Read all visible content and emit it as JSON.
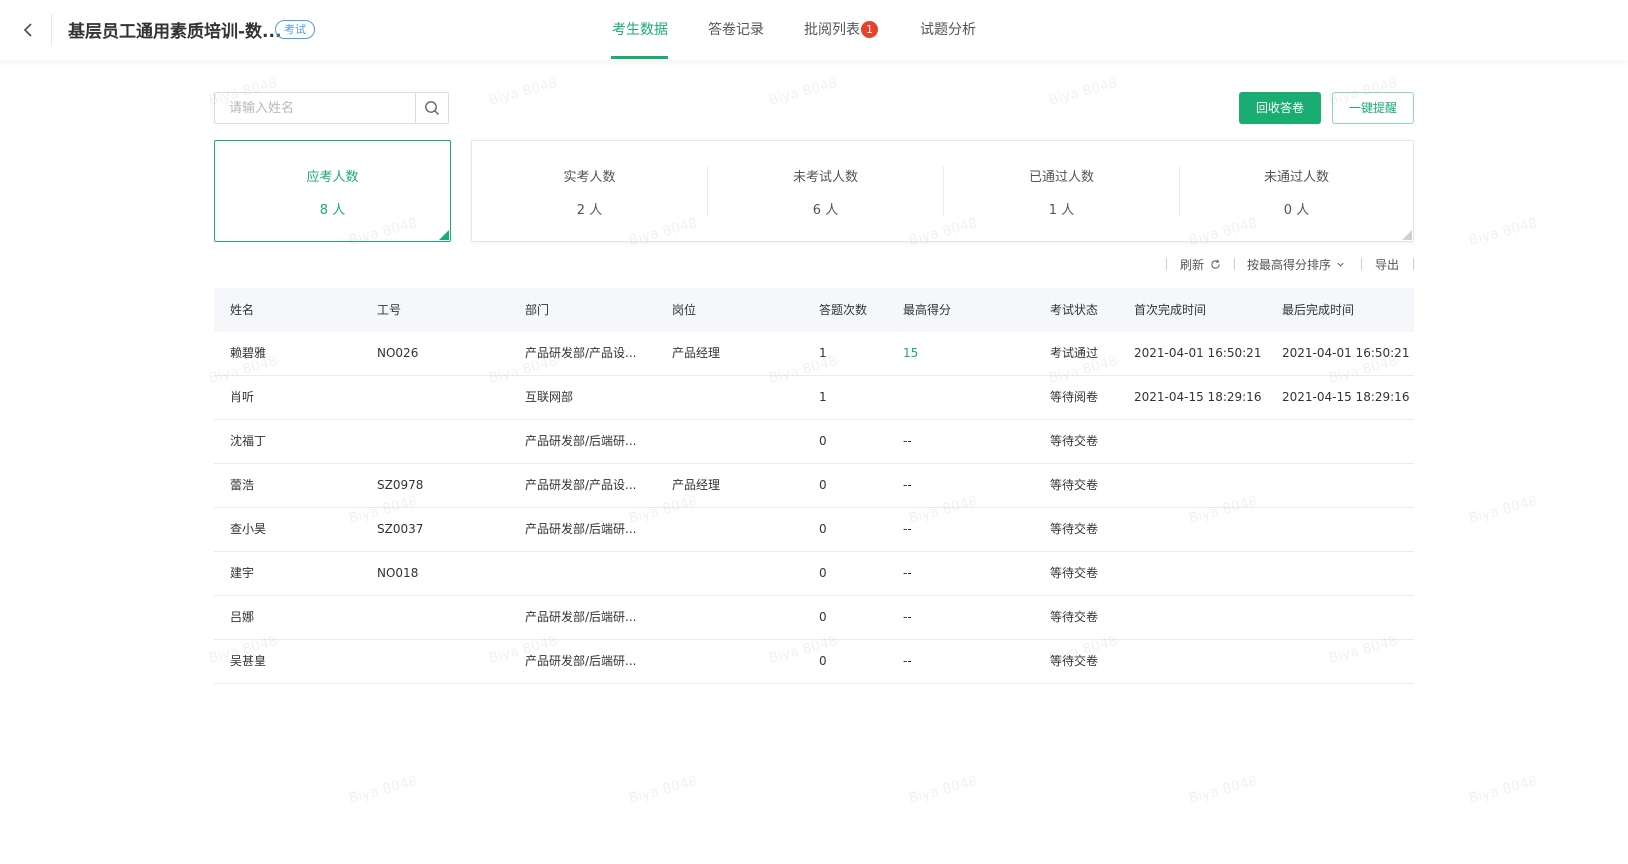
{
  "header": {
    "title": "基层员工通用素质培训-数...",
    "badge": "考试",
    "tabs": [
      {
        "label": "考生数据",
        "active": true
      },
      {
        "label": "答卷记录",
        "active": false
      },
      {
        "label": "批阅列表",
        "active": false,
        "badge": "1"
      },
      {
        "label": "试题分析",
        "active": false
      }
    ]
  },
  "search": {
    "placeholder": "请输入姓名",
    "value": ""
  },
  "actions": {
    "recall_label": "回收答卷",
    "remind_label": "一键提醒"
  },
  "stats": [
    {
      "label": "应考人数",
      "value": "8 人"
    },
    {
      "label": "实考人数",
      "value": "2 人"
    },
    {
      "label": "未考试人数",
      "value": "6 人"
    },
    {
      "label": "已通过人数",
      "value": "1 人"
    },
    {
      "label": "未通过人数",
      "value": "0 人"
    }
  ],
  "toolbar": {
    "refresh": "刷新",
    "sort": "按最高得分排序",
    "export": "导出"
  },
  "table": {
    "columns": [
      "姓名",
      "工号",
      "部门",
      "岗位",
      "答题次数",
      "最高得分",
      "考试状态",
      "首次完成时间",
      "最后完成时间"
    ],
    "rows": [
      [
        "赖碧雅",
        "NO026",
        "产品研发部/产品设...",
        "产品经理",
        "1",
        "15",
        "考试通过",
        "2021-04-01 16:50:21",
        "2021-04-01 16:50:21"
      ],
      [
        "肖听",
        "",
        "互联网部",
        "",
        "1",
        "",
        "等待阅卷",
        "2021-04-15 18:29:16",
        "2021-04-15 18:29:16"
      ],
      [
        "沈福丁",
        "",
        "产品研发部/后端研...",
        "",
        "0",
        "--",
        "等待交卷",
        "",
        ""
      ],
      [
        "蕾浩",
        "SZ0978",
        "产品研发部/产品设...",
        "产品经理",
        "0",
        "--",
        "等待交卷",
        "",
        ""
      ],
      [
        "查小昊",
        "SZ0037",
        "产品研发部/后端研...",
        "",
        "0",
        "--",
        "等待交卷",
        "",
        ""
      ],
      [
        "建宇",
        "NO018",
        "",
        "",
        "0",
        "--",
        "等待交卷",
        "",
        ""
      ],
      [
        "吕娜",
        "",
        "产品研发部/后端研...",
        "",
        "0",
        "--",
        "等待交卷",
        "",
        ""
      ],
      [
        "吴甚皇",
        "",
        "产品研发部/后端研...",
        "",
        "0",
        "--",
        "等待交卷",
        "",
        ""
      ]
    ]
  },
  "watermark": "Biya 8048",
  "colors": {
    "accent": "#1aad72",
    "badge": "#e8412b",
    "info": "#4c9cf0"
  }
}
